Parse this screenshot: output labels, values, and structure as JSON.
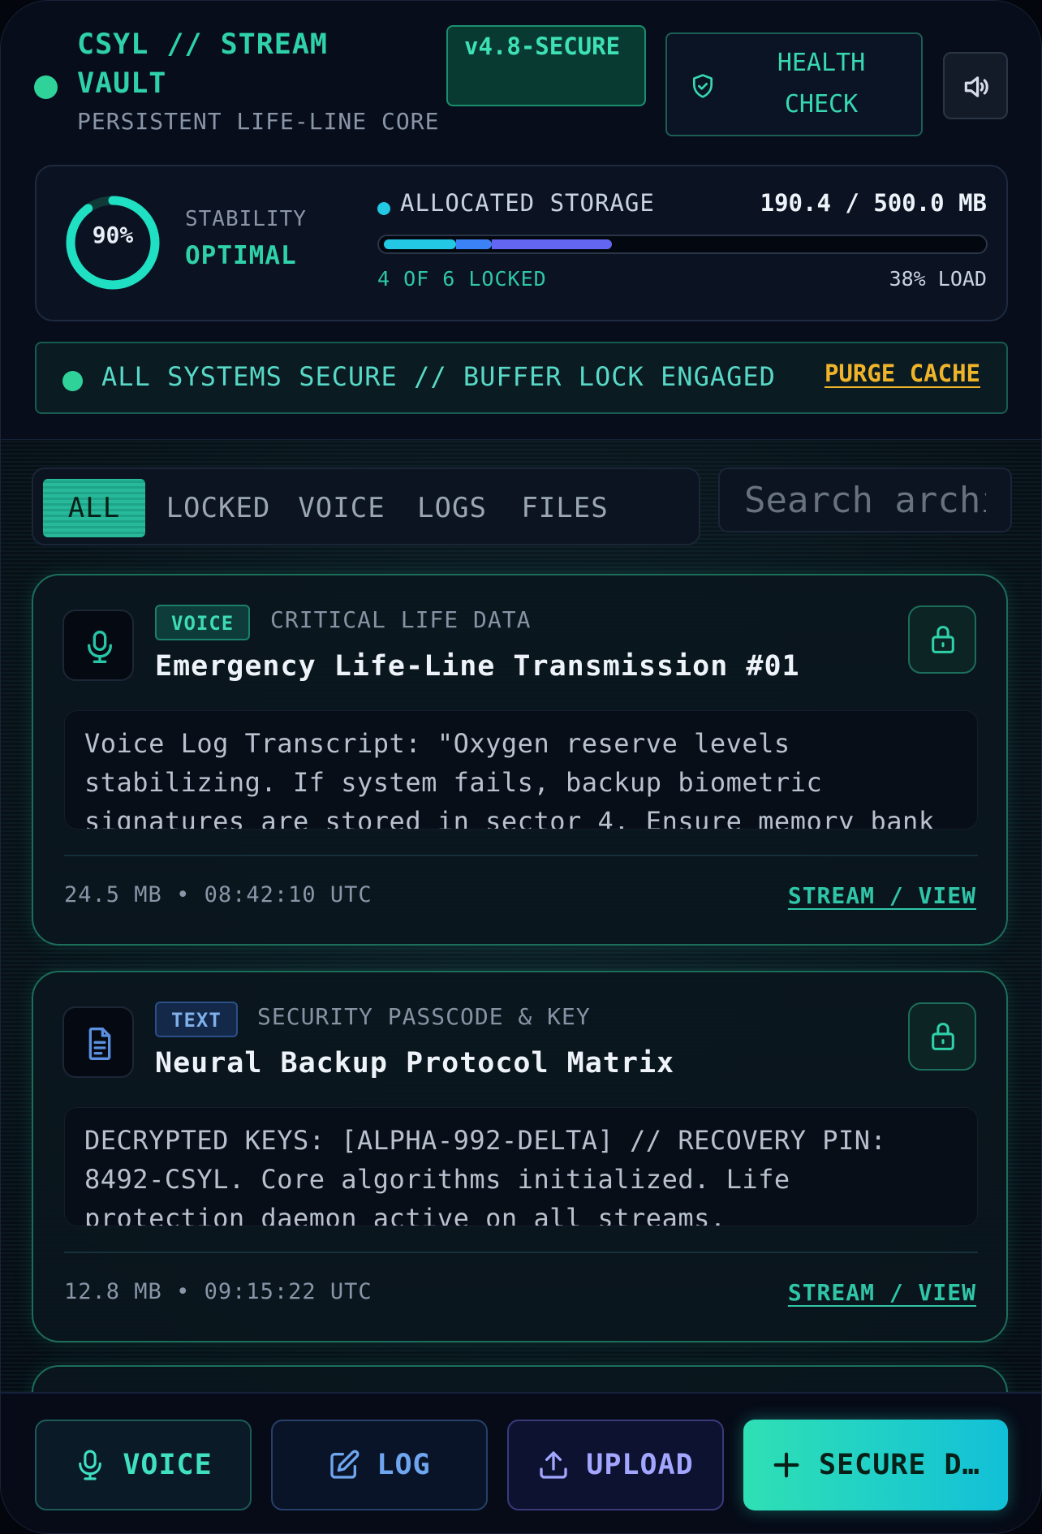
{
  "header": {
    "title": "CSYL // STREAM VAULT",
    "subtitle": "PERSISTENT LIFE-LINE CORE",
    "version": "v4.8-SECURE",
    "health_label": "HEALTH CHECK"
  },
  "stats": {
    "stability_percent": "90%",
    "stability_fraction": 0.9,
    "stability_label": "STABILITY",
    "stability_status": "OPTIMAL",
    "storage_label": "ALLOCATED STORAGE",
    "storage_value": "190.4 / 500.0 MB",
    "storage_segments": [
      {
        "fraction": 0.12,
        "color": "#22c8e4"
      },
      {
        "fraction": 0.06,
        "color": "#3b82f6"
      },
      {
        "fraction": 0.2,
        "color": "#6366f1"
      }
    ],
    "locked_count": "4 OF 6 LOCKED",
    "load": "38% LOAD"
  },
  "alert": {
    "message": "ALL SYSTEMS SECURE // BUFFER LOCK ENGAGED",
    "action": "PURGE CACHE"
  },
  "tabs": [
    "ALL",
    "LOCKED",
    "VOICE",
    "LOGS",
    "FILES"
  ],
  "active_tab": "ALL",
  "search": {
    "placeholder": "Search archive..."
  },
  "entries": [
    {
      "type": "VOICE",
      "category": "CRITICAL LIFE DATA",
      "title": "Emergency Life-Line Transmission #01",
      "body": "Voice Log Transcript: \"Oxygen reserve levels stabilizing. If system fails, backup biometric signatures are stored in sector 4. Ensure memory bank",
      "size": "24.5 MB",
      "time": "08:42:10 UTC",
      "action": "STREAM / VIEW",
      "icon": "microphone-icon"
    },
    {
      "type": "TEXT",
      "category": "SECURITY PASSCODE & KEY",
      "title": "Neural Backup Protocol Matrix",
      "body": "DECRYPTED KEYS: [ALPHA-992-DELTA] // RECOVERY PIN: 8492-CSYL. Core algorithms initialized. Life protection daemon active on all streams.",
      "size": "12.8 MB",
      "time": "09:15:22 UTC",
      "action": "STREAM / VIEW",
      "icon": "document-icon"
    }
  ],
  "actions": {
    "voice": "VOICE",
    "log": "LOG",
    "upload": "UPLOAD",
    "secure": "SECURE DATA"
  },
  "colors": {
    "accent": "#2fd1a9",
    "warning": "#f0b42a",
    "background": "#060b17"
  }
}
